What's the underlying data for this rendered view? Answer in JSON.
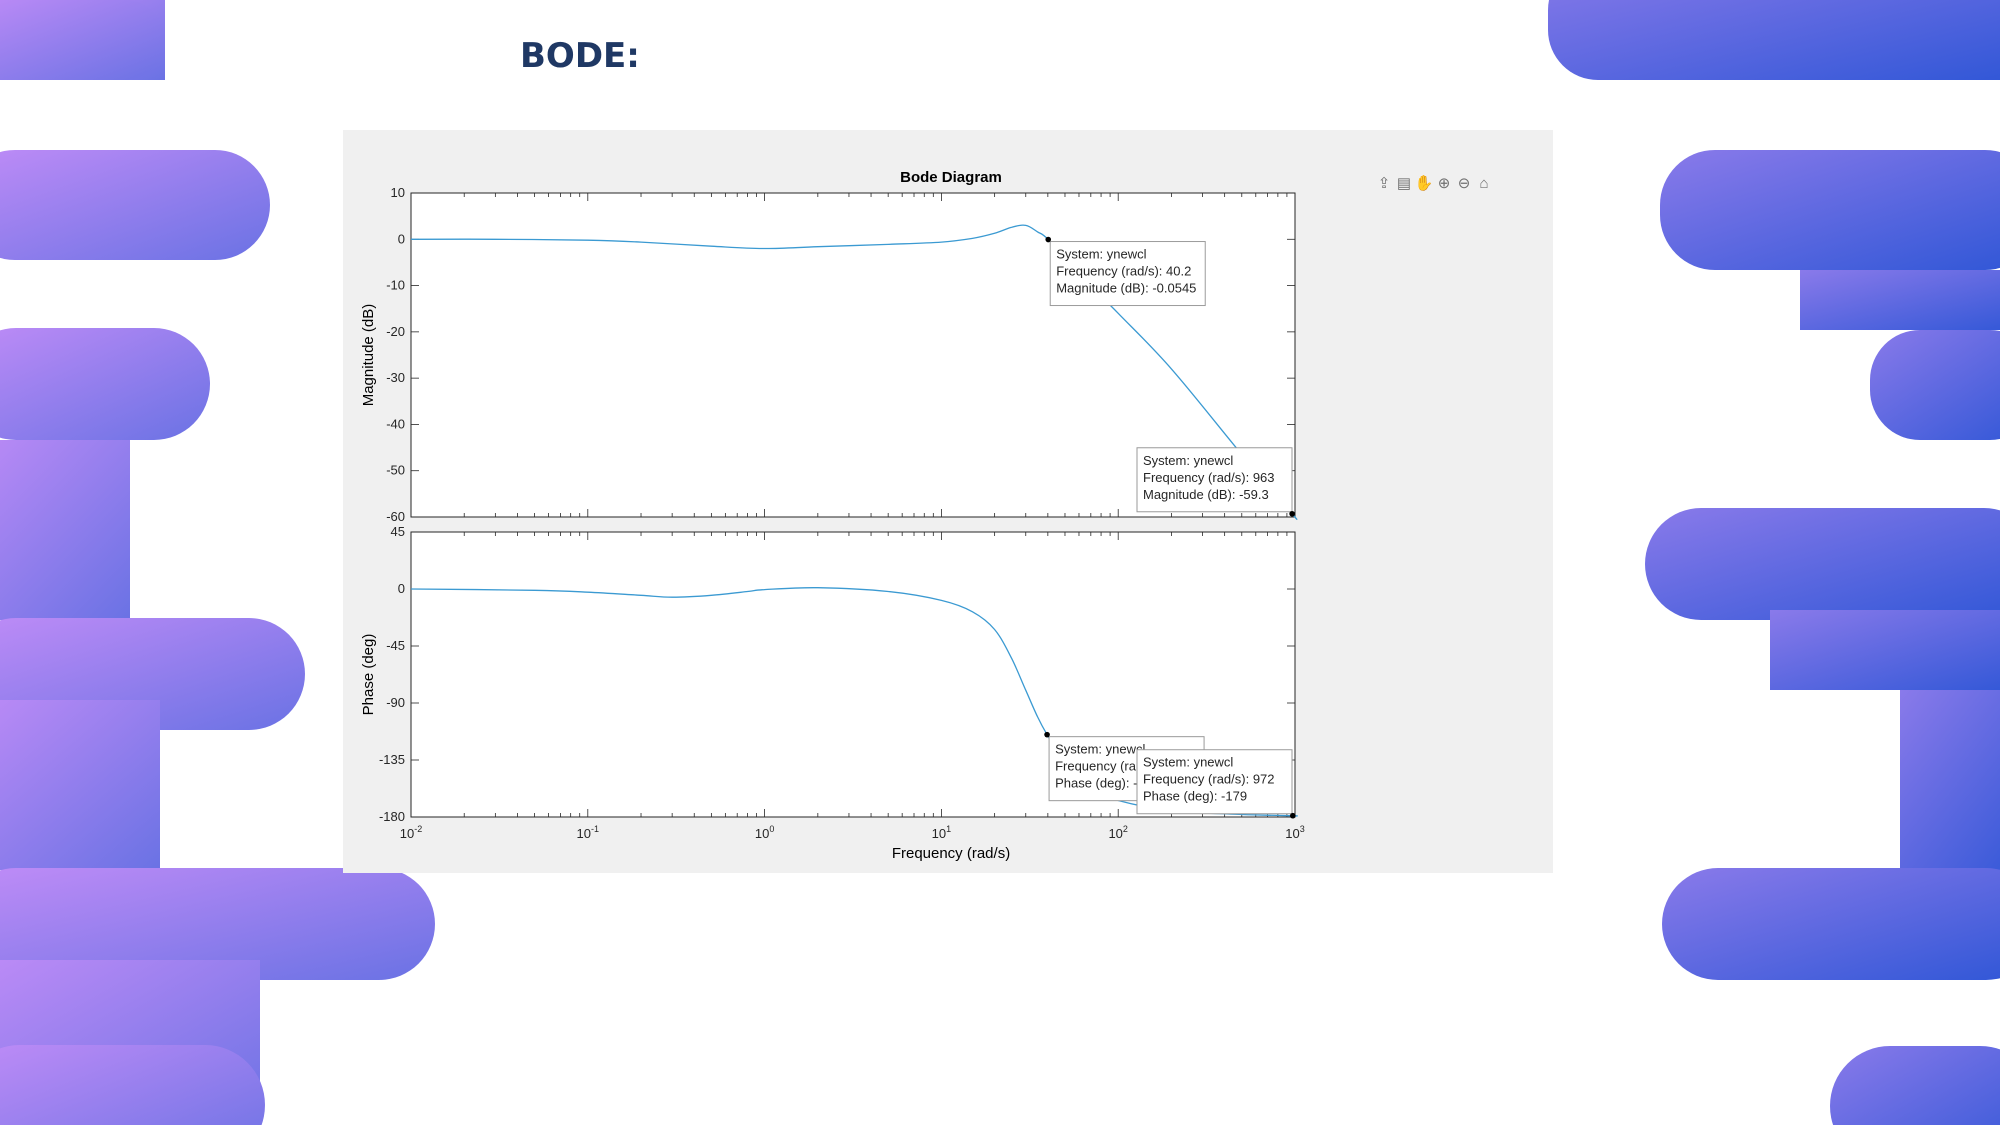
{
  "slide": {
    "title": "BODE:"
  },
  "colors": {
    "grad_left_start": "#c08cf7",
    "grad_left_end": "#6a72e4",
    "grad_right_start": "#8a7aea",
    "grad_right_end": "#2e56d6",
    "series": "#3b9ad2",
    "figure_bg": "#f0f0f0",
    "title_text": "#1f3864"
  },
  "toolbar": {
    "icons": [
      "export-icon",
      "datatip-icon",
      "pan-hand-icon",
      "zoom-in-icon",
      "zoom-out-icon",
      "home-icon"
    ]
  },
  "chart_data": {
    "type": "line",
    "title": "Bode Diagram",
    "xlabel": "Frequency  (rad/s)",
    "xscale": "log",
    "xlim": [
      0.01,
      1000
    ],
    "x_ticks": [
      {
        "base": "10",
        "exp": "-2"
      },
      {
        "base": "10",
        "exp": "-1"
      },
      {
        "base": "10",
        "exp": "0"
      },
      {
        "base": "10",
        "exp": "1"
      },
      {
        "base": "10",
        "exp": "2"
      },
      {
        "base": "10",
        "exp": "3"
      }
    ],
    "grid": false,
    "panels": [
      {
        "name": "magnitude",
        "ylabel": "Magnitude (dB)",
        "ylim": [
          -60,
          10
        ],
        "y_ticks": [
          "10",
          "0",
          "-10",
          "-20",
          "-30",
          "-40",
          "-50",
          "-60"
        ],
        "series": [
          {
            "x": [
              0.01,
              0.03,
              0.1,
              0.2,
              0.5,
              1,
              2,
              5,
              10,
              15,
              20,
              25,
              30,
              35,
              40.2,
              60,
              100,
              200,
              500,
              963,
              1000
            ],
            "y": [
              0,
              0,
              -0.2,
              -0.6,
              -1.5,
              -2.0,
              -1.6,
              -1.1,
              -0.6,
              0.2,
              1.3,
              2.6,
              3.0,
              1.6,
              -0.0545,
              -7.5,
              -16.0,
              -28.0,
              -46.5,
              -59.3,
              -60.0
            ]
          }
        ],
        "datatips": [
          {
            "x": 40.2,
            "y": -0.0545,
            "lines": [
              "System: ynewcl",
              "Frequency (rad/s): 40.2",
              "Magnitude (dB): -0.0545"
            ]
          },
          {
            "x": 963,
            "y": -59.3,
            "lines": [
              "System: ynewcl",
              "Frequency (rad/s): 963",
              "Magnitude (dB): -59.3"
            ]
          }
        ]
      },
      {
        "name": "phase",
        "ylabel": "Phase (deg)",
        "ylim": [
          -180,
          45
        ],
        "y_ticks": [
          "45",
          "0",
          "-45",
          "-90",
          "-135",
          "-180"
        ],
        "series": [
          {
            "x": [
              0.01,
              0.05,
              0.1,
              0.2,
              0.3,
              0.5,
              0.8,
              1,
              2,
              5,
              10,
              15,
              20,
              25,
              30,
              35,
              39.6,
              50,
              70,
              100,
              200,
              500,
              972,
              1000
            ],
            "y": [
              0,
              -1,
              -2.5,
              -5,
              -6.5,
              -5,
              -2,
              -0.5,
              1,
              -2,
              -9,
              -18,
              -32,
              -55,
              -80,
              -101,
              -115,
              -138,
              -158,
              -167,
              -175,
              -178,
              -179,
              -179.2
            ]
          }
        ],
        "datatips": [
          {
            "x": 39.6,
            "y": -115,
            "lines": [
              "System: ynewcl",
              "Frequency (rad/s): 39.6",
              "Phase (deg): -115"
            ]
          },
          {
            "x": 972,
            "y": -179,
            "lines": [
              "System: ynewcl",
              "Frequency (rad/s): 972",
              "Phase (deg): -179"
            ]
          }
        ]
      }
    ]
  }
}
